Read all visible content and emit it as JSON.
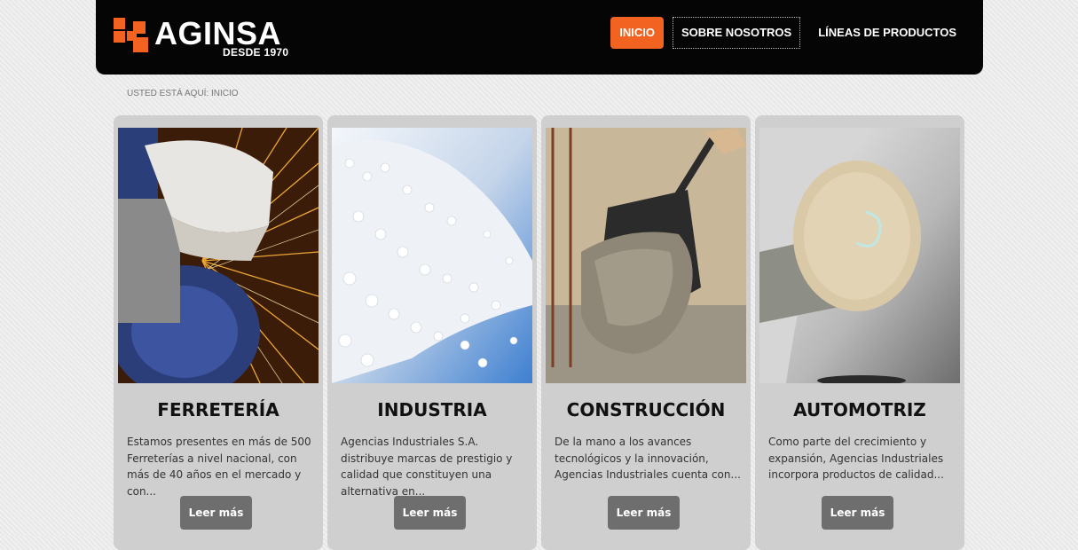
{
  "header": {
    "logo_text": "AGINSA",
    "logo_subtext": "DESDE 1970",
    "brand_color": "#f26322",
    "nav": [
      {
        "label": "INICIO",
        "active": true
      },
      {
        "label": "SOBRE NOSOTROS",
        "active": false
      },
      {
        "label": "LÍNEAS DE PRODUCTOS",
        "active": false
      }
    ]
  },
  "breadcrumb": "USTED ESTÁ AQUÍ: INICIO",
  "cards": [
    {
      "title": "FERRETERÍA",
      "text": "Estamos presentes en más de 500 Ferreterías a nivel nacional, con más de 40 años en el mercado y con...",
      "button": "Leer más",
      "image": "angle-grinder-sparks"
    },
    {
      "title": "INDUSTRIA",
      "text": "Agencias Industriales S.A. distribuye marcas de prestigio y calidad que constituyen una alternativa en...",
      "button": "Leer más",
      "image": "white-plastic-pellets"
    },
    {
      "title": "CONSTRUCCIÓN",
      "text": "De la mano a los avances tecnológicos y la innovación, Agencias Industriales cuenta con...",
      "button": "Leer más",
      "image": "shovel-with-cement"
    },
    {
      "title": "AUTOMOTRIZ",
      "text": "Como parte del crecimiento y expansión, Agencias Industriales incorpora productos de calidad...",
      "button": "Leer más",
      "image": "car-polishing-pad"
    }
  ]
}
